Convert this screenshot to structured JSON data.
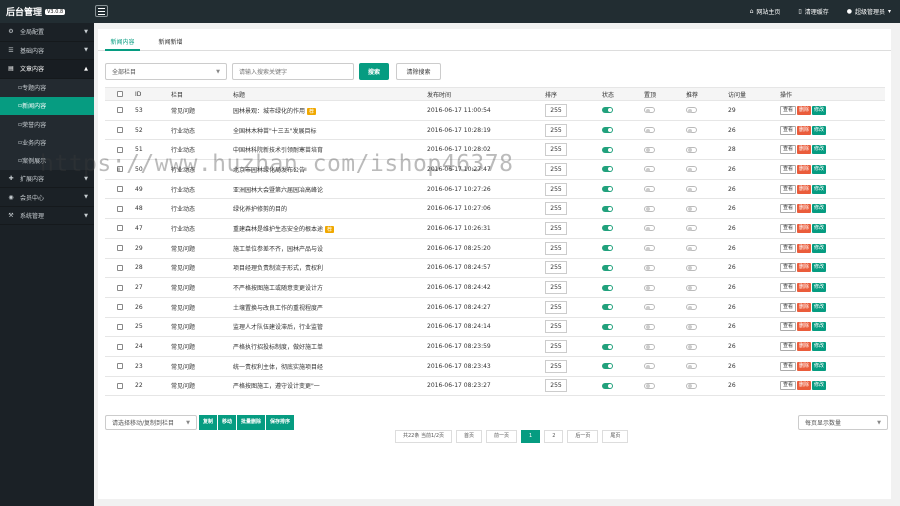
{
  "app": {
    "title": "后台管理",
    "version": "V3.0.8"
  },
  "top_links": [
    {
      "icon": "home-icon",
      "label": "网站主页"
    },
    {
      "icon": "trash-icon",
      "label": "清理缓存"
    },
    {
      "icon": "user-icon",
      "label": "超级管理员"
    }
  ],
  "sidebar": {
    "items": [
      {
        "label": "全局配置",
        "type": "nav"
      },
      {
        "label": "基础内容",
        "type": "nav"
      },
      {
        "label": "文章内容",
        "type": "nav",
        "open": true
      },
      {
        "label": "专题内容",
        "type": "sub"
      },
      {
        "label": "新闻内容",
        "type": "sub",
        "active": true
      },
      {
        "label": "荣誉内容",
        "type": "sub"
      },
      {
        "label": "业务内容",
        "type": "sub"
      },
      {
        "label": "案例展示",
        "type": "sub"
      },
      {
        "label": "扩展内容",
        "type": "nav"
      },
      {
        "label": "会员中心",
        "type": "nav"
      },
      {
        "label": "系统管理",
        "type": "nav"
      }
    ]
  },
  "tabs": [
    {
      "label": "新闻内容",
      "active": true
    },
    {
      "label": "新闻新增"
    }
  ],
  "filter": {
    "category_selected": "全部栏目",
    "search_placeholder": "请输入搜索关键字",
    "search_button": "搜索",
    "clear_button": "清除搜索"
  },
  "table": {
    "headers": [
      "",
      "ID",
      "栏目",
      "标题",
      "发布时间",
      "排序",
      "状态",
      "置顶",
      "推荐",
      "访问量",
      "操作"
    ],
    "actions": {
      "view": "查看",
      "delete": "删除",
      "edit": "修改"
    },
    "rows": [
      {
        "id": "53",
        "cat": "常见问题",
        "title": "园林景观：城市绿化的作用",
        "hot": "荐",
        "time": "2016-06-17 11:00:54",
        "ord": "255",
        "status": true,
        "top": false,
        "rec": false,
        "visits": "29"
      },
      {
        "id": "52",
        "cat": "行业动态",
        "title": "全国林木种苗\"十三五\"发展目标",
        "hot": "",
        "time": "2016-06-17 10:28:19",
        "ord": "255",
        "status": true,
        "top": false,
        "rec": false,
        "visits": "26"
      },
      {
        "id": "51",
        "cat": "行业动态",
        "title": "中国林科院新技术引领耐寒苗培育",
        "hot": "",
        "time": "2016-06-17 10:28:02",
        "ord": "255",
        "status": true,
        "top": false,
        "rec": false,
        "visits": "28"
      },
      {
        "id": "50",
        "cat": "行业动态",
        "title": "北京市园林绿化局发布公告",
        "hot": "",
        "time": "2016-06-17 10:27:47",
        "ord": "255",
        "status": true,
        "top": false,
        "rec": false,
        "visits": "26"
      },
      {
        "id": "49",
        "cat": "行业动态",
        "title": "亚洲园林大会暨第六届园冶高峰论",
        "hot": "",
        "time": "2016-06-17 10:27:26",
        "ord": "255",
        "status": true,
        "top": false,
        "rec": false,
        "visits": "26"
      },
      {
        "id": "48",
        "cat": "行业动态",
        "title": "绿化养护修剪的目的",
        "hot": "",
        "time": "2016-06-17 10:27:06",
        "ord": "255",
        "status": true,
        "top": false,
        "rec": false,
        "visits": "26"
      },
      {
        "id": "47",
        "cat": "行业动态",
        "title": "重建森林是维护生态安全的根本途",
        "hot": "荐",
        "time": "2016-06-17 10:26:31",
        "ord": "255",
        "status": true,
        "top": false,
        "rec": false,
        "visits": "26"
      },
      {
        "id": "29",
        "cat": "常见问题",
        "title": "施工单位参差不齐，园林产品与设",
        "hot": "",
        "time": "2016-06-17 08:25:20",
        "ord": "255",
        "status": true,
        "top": false,
        "rec": false,
        "visits": "26"
      },
      {
        "id": "28",
        "cat": "常见问题",
        "title": "项目经理负责制流于形式，责权利",
        "hot": "",
        "time": "2016-06-17 08:24:57",
        "ord": "255",
        "status": true,
        "top": false,
        "rec": false,
        "visits": "26"
      },
      {
        "id": "27",
        "cat": "常见问题",
        "title": "不严格按图施工或随意变更设计方",
        "hot": "",
        "time": "2016-06-17 08:24:42",
        "ord": "255",
        "status": true,
        "top": false,
        "rec": false,
        "visits": "26"
      },
      {
        "id": "26",
        "cat": "常见问题",
        "title": "土壤置换与改良工作的重视程度严",
        "hot": "",
        "time": "2016-06-17 08:24:27",
        "ord": "255",
        "status": true,
        "top": false,
        "rec": false,
        "visits": "26"
      },
      {
        "id": "25",
        "cat": "常见问题",
        "title": "监理人才队伍建设滞后，行业监管",
        "hot": "",
        "time": "2016-06-17 08:24:14",
        "ord": "255",
        "status": true,
        "top": false,
        "rec": false,
        "visits": "26"
      },
      {
        "id": "24",
        "cat": "常见问题",
        "title": "严格执行招投标制度，做好施工单",
        "hot": "",
        "time": "2016-06-17 08:23:59",
        "ord": "255",
        "status": true,
        "top": false,
        "rec": false,
        "visits": "26"
      },
      {
        "id": "23",
        "cat": "常见问题",
        "title": "统一责权利主体，彻底实施项目经",
        "hot": "",
        "time": "2016-06-17 08:23:43",
        "ord": "255",
        "status": true,
        "top": false,
        "rec": false,
        "visits": "26"
      },
      {
        "id": "22",
        "cat": "常见问题",
        "title": "严格按图施工，遵守设计变更\"一",
        "hot": "",
        "time": "2016-06-17 08:23:27",
        "ord": "255",
        "status": true,
        "top": false,
        "rec": false,
        "visits": "26"
      }
    ]
  },
  "batch": {
    "select_placeholder": "请选择移动/复制到栏目",
    "buttons": [
      "复制",
      "移动",
      "批量删除",
      "保存排序"
    ]
  },
  "page_size": {
    "label": "每页显示数量"
  },
  "pager": {
    "info": "共22条 当前1/2页",
    "first": "首页",
    "prev": "前一页",
    "pages": [
      "1",
      "2"
    ],
    "current": "1",
    "next": "后一页",
    "last": "尾页"
  },
  "watermark": "https://www.huzhan.com/ishop46378",
  "colors": {
    "accent": "#069c81",
    "danger": "#ea5c3b",
    "hot": "#f0a800",
    "topbar": "#222d32",
    "sidebar": "#1b2126"
  }
}
